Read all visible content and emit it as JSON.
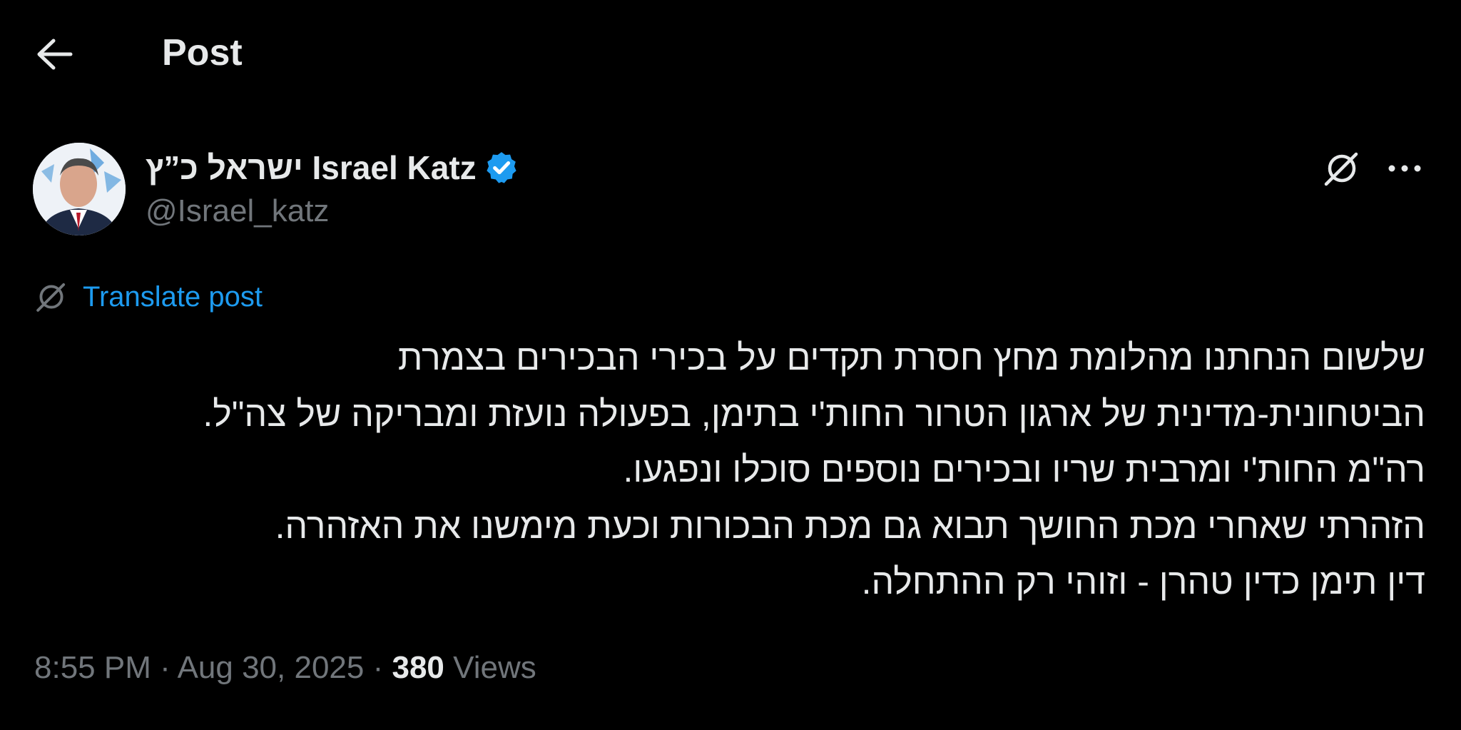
{
  "header": {
    "title": "Post"
  },
  "author": {
    "name": "ישראל כ”ץ Israel Katz",
    "handle": "@Israel_katz"
  },
  "translate": {
    "label": "Translate post"
  },
  "post": {
    "lines": [
      "שלשום הנחתנו מהלומת מחץ חסרת תקדים על בכירי הבכירים בצמרת",
      "הביטחונית-מדינית של ארגון הטרור החות'י בתימן, בפעולה נועזת ומבריקה של צה\"ל.",
      "רה\"מ החות'י ומרבית שריו ובכירים נוספים סוכלו ונפגעו.",
      "הזהרתי שאחרי מכת החושך תבוא גם מכת הבכורות וכעת מימשנו את האזהרה.",
      "דין תימן כדין טהרן - וזוהי רק ההתחלה."
    ]
  },
  "meta": {
    "time": "8:55 PM",
    "separator": "·",
    "date": "Aug 30, 2025",
    "views_count": "380",
    "views_label": "Views"
  },
  "colors": {
    "background": "#000000",
    "text": "#e7e9ea",
    "muted": "#71767b",
    "accent": "#1d9bf0",
    "verified": "#1d9bf0"
  },
  "icons": {
    "back": "arrow-left-icon",
    "verified": "verified-badge-icon",
    "grok": "grok-icon",
    "more": "more-dots-icon",
    "translate": "grok-icon"
  }
}
